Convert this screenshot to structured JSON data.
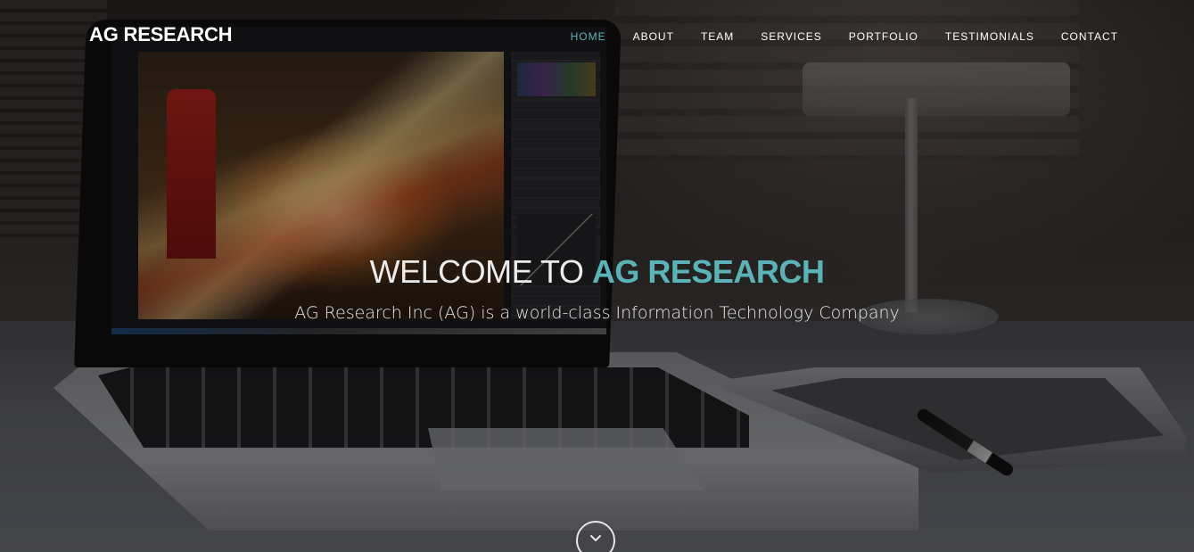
{
  "brand": {
    "logo_text": "AG RESEARCH"
  },
  "nav": {
    "items": [
      {
        "label": "HOME",
        "active": true
      },
      {
        "label": "ABOUT",
        "active": false
      },
      {
        "label": "TEAM",
        "active": false
      },
      {
        "label": "SERVICES",
        "active": false
      },
      {
        "label": "PORTFOLIO",
        "active": false
      },
      {
        "label": "TESTIMONIALS",
        "active": false
      },
      {
        "label": "CONTACT",
        "active": false
      }
    ]
  },
  "hero": {
    "title_prefix": "WELCOME TO ",
    "title_accent": "AG RESEARCH",
    "subtitle": "AG Research Inc (AG) is a world-class Information Technology Company",
    "scroll_icon": "chevron-down-icon"
  },
  "colors": {
    "accent": "#5ab3b6",
    "nav_text": "#ffffff",
    "overlay": "rgba(0,0,0,0.38)"
  }
}
